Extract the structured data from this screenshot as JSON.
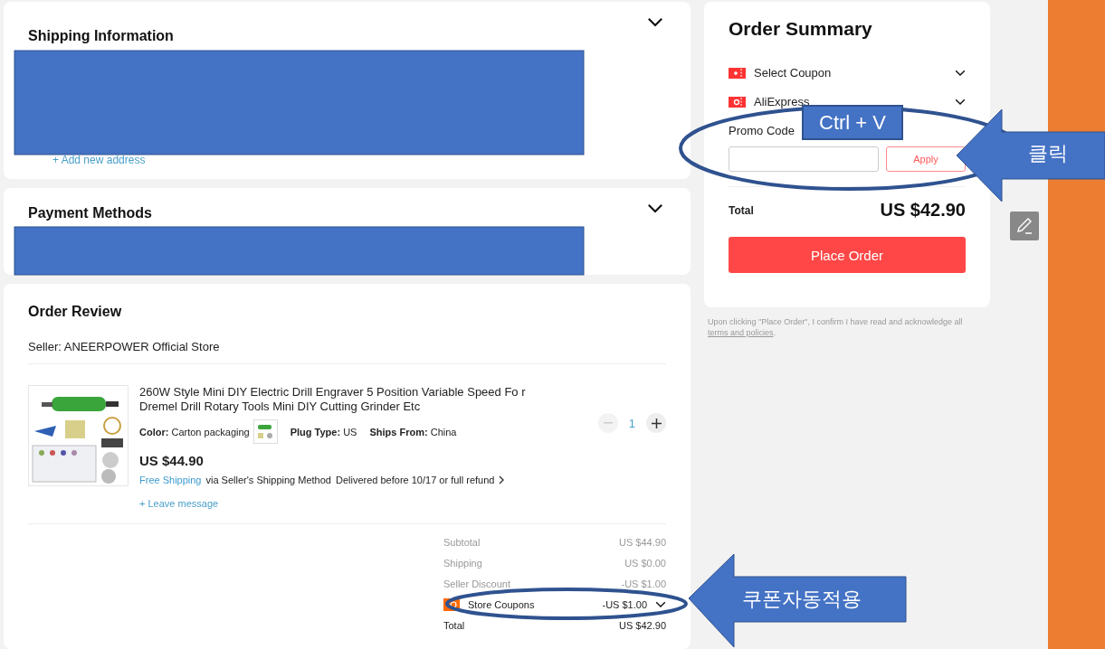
{
  "shipping": {
    "title": "Shipping Information",
    "add_address": "+ Add new address"
  },
  "payment": {
    "title": "Payment Methods"
  },
  "order_review": {
    "title": "Order Review",
    "seller": "Seller: ANEERPOWER Official Store",
    "item": {
      "title": "260W Style Mini DIY Electric Drill Engraver 5 Position Variable Speed Fo r Dremel Drill Rotary Tools Mini DIY Cutting Grinder Etc",
      "attributes": [
        {
          "label": "Color:",
          "value": "Carton packaging",
          "thumbnail": true
        },
        {
          "label": "Plug Type:",
          "value": "US",
          "thumbnail": false
        },
        {
          "label": "Ships From:",
          "value": "China",
          "thumbnail": false
        }
      ],
      "price": "US $44.90",
      "free_shipping": "Free Shipping",
      "shipping_method": "via Seller's Shipping Method",
      "delivery": "Delivered before 10/17 or full refund",
      "leave_message": "+ Leave message",
      "quantity": "1",
      "decrease_disabled": true
    },
    "summary": [
      {
        "kind": "plain",
        "label": "Subtotal",
        "value": "US $44.90"
      },
      {
        "kind": "plain",
        "label": "Shipping",
        "value": "US $0.00"
      },
      {
        "kind": "plain",
        "label": "Seller Discount",
        "value": "-US $1.00"
      },
      {
        "kind": "coupon",
        "label": "Store Coupons",
        "value": "-US $1.00"
      },
      {
        "kind": "total",
        "label": "Total",
        "value": "US $42.90"
      }
    ]
  },
  "order_summary": {
    "title": "Order Summary",
    "coupons": [
      {
        "kind": "plus",
        "label": "Select Coupon"
      },
      {
        "kind": "dollar",
        "label": "AliExpress"
      }
    ],
    "promo_label": "Promo Code",
    "apply": "Apply",
    "total_label": "Total",
    "total": "US $42.90",
    "place_order": "Place Order"
  },
  "disclaimer": {
    "text": "Upon clicking \"Place Order\", I confirm I have read and acknowledge all",
    "link": "terms and policies",
    "end": "."
  },
  "annotations": {
    "paste_label": "Ctrl + V",
    "click_label": "클릭",
    "auto_coupon_label": "쿠폰자동적용"
  }
}
